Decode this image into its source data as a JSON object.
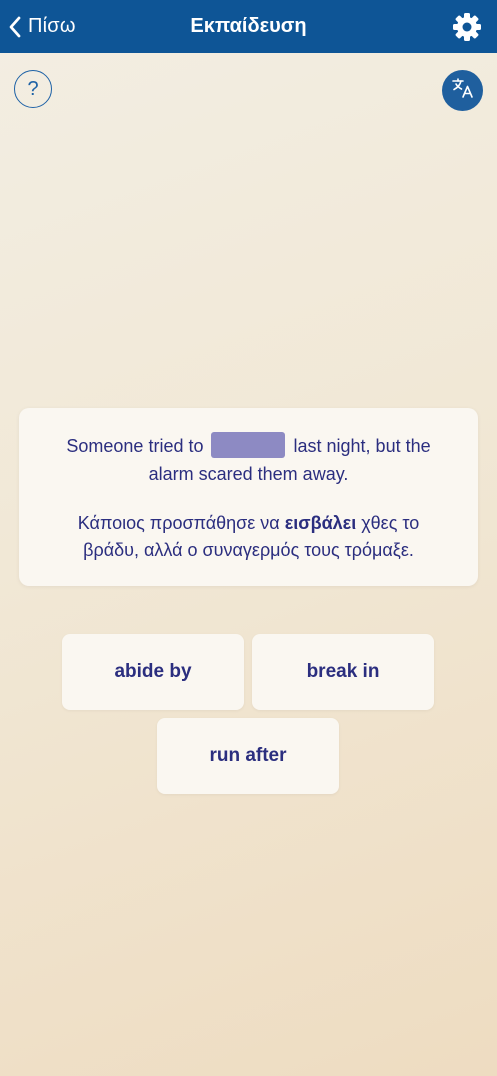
{
  "nav": {
    "back_label": "Πίσω",
    "title": "Εκπαίδευση",
    "back_icon": "chevron-left-icon",
    "settings_icon": "gear-icon"
  },
  "toolbar": {
    "help_label": "?",
    "translate_icon": "translate-icon"
  },
  "exercise": {
    "sentence_before": "Someone tried to",
    "sentence_after": "last night, but the alarm scared them away.",
    "translation_before": "Κάποιος προσπάθησε να",
    "translation_highlight": "εισβάλει",
    "translation_after": "χθες το βράδυ, αλλά ο συναγερμός τους τρόμαξε."
  },
  "options": [
    "abide by",
    "break in",
    "run after"
  ],
  "colors": {
    "nav_bar": "#0e5596",
    "accent": "#1f5f9e",
    "text": "#2b2e7f",
    "blank": "#8d8ac3",
    "card": "#faf7f1"
  }
}
